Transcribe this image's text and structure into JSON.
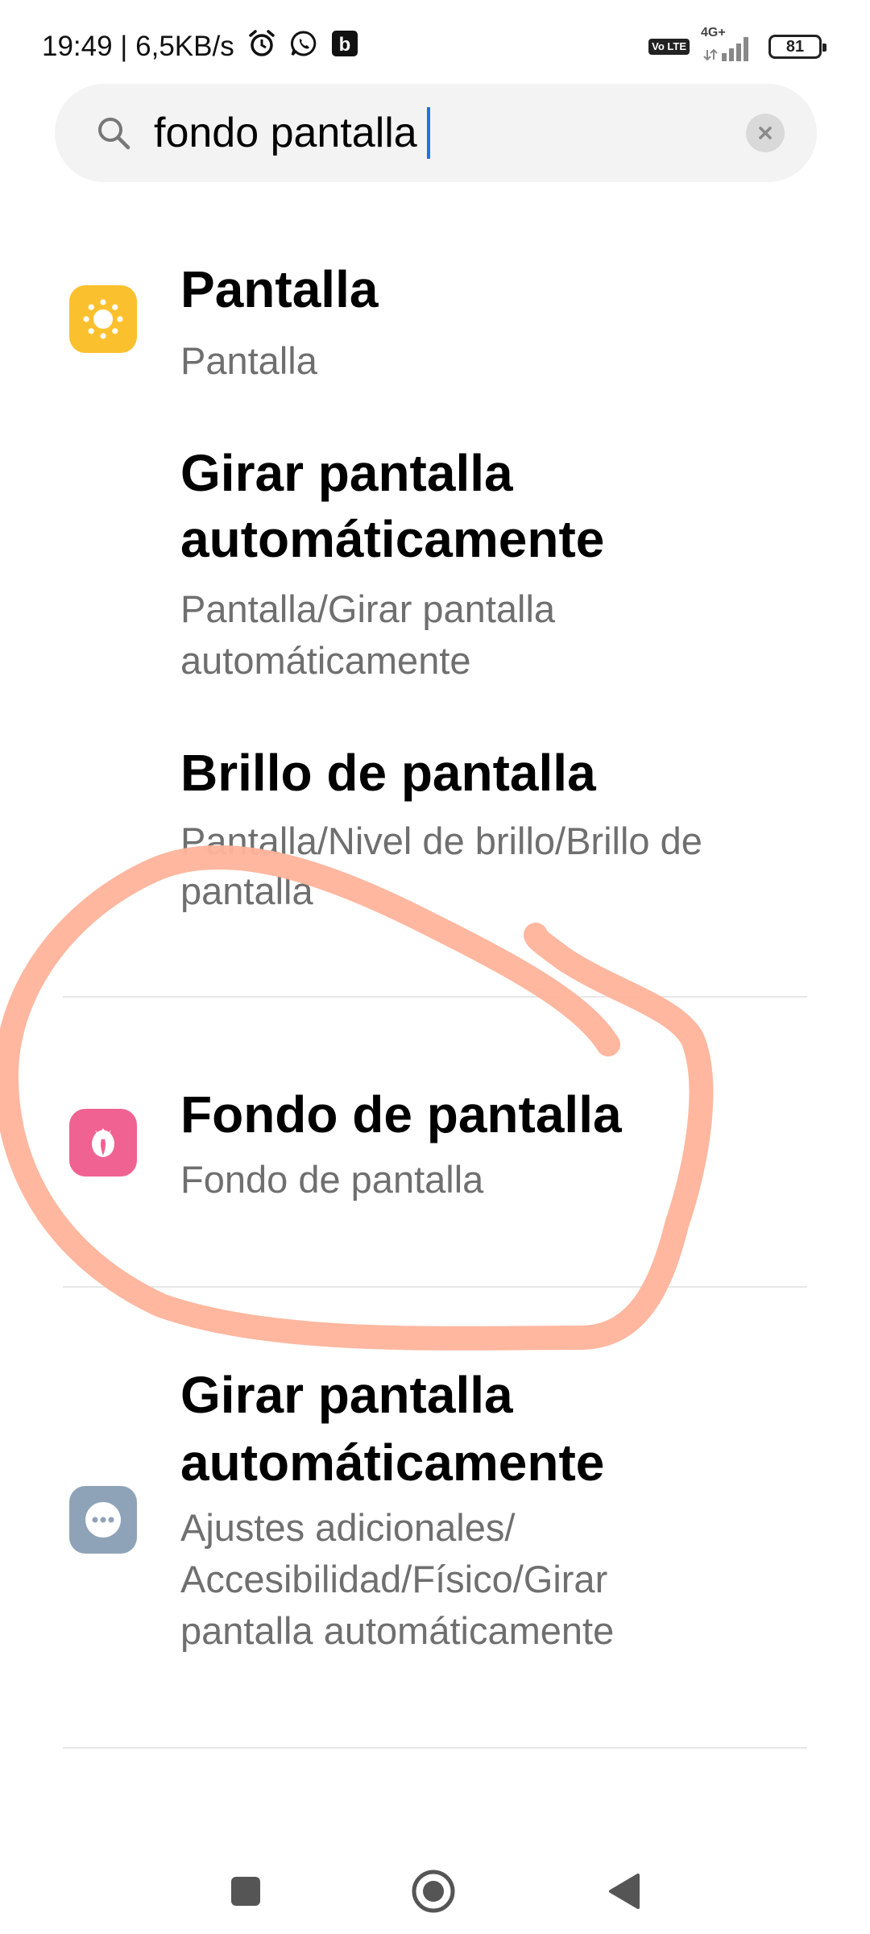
{
  "status_bar": {
    "time_speed": "19:49 | 6,5KB/s",
    "network_type": "4G+",
    "volte_label": "Vo LTE",
    "battery_level": "81",
    "icons": [
      "alarm-icon",
      "whatsapp-icon",
      "b-notification-icon",
      "volte-icon",
      "signal-icon",
      "battery-icon"
    ],
    "b_badge": "b"
  },
  "search": {
    "query": "fondo pantalla",
    "icon": "search-icon",
    "clear_icon": "close-icon"
  },
  "results": [
    {
      "title": "Pantalla",
      "subtitle": "Pantalla",
      "icon": "display-brightness-icon",
      "icon_color": "#FBC02D"
    },
    {
      "title_line1": "Girar pantalla",
      "title_line2": "automáticamente",
      "subtitle_line1": "Pantalla/Girar pantalla",
      "subtitle_line2": "automáticamente"
    },
    {
      "title": "Brillo de pantalla",
      "subtitle_line1": "Pantalla/Nivel de brillo/Brillo de",
      "subtitle_line2": "pantalla"
    },
    {
      "title": "Fondo de pantalla",
      "subtitle": "Fondo de pantalla",
      "icon": "wallpaper-tulip-icon",
      "icon_color": "#F06292"
    },
    {
      "title_line1": "Girar pantalla",
      "title_line2": "automáticamente",
      "subtitle_line1": "Ajustes adicionales/",
      "subtitle_line2": "Accesibilidad/Físico/Girar",
      "subtitle_line3": "pantalla automáticamente",
      "icon": "more-settings-icon",
      "icon_color": "#8FA3B8"
    }
  ],
  "annotation": {
    "color": "#FFB39A"
  },
  "nav_bar": {
    "icons": [
      "recents-square-icon",
      "home-circle-icon",
      "back-triangle-icon"
    ]
  }
}
